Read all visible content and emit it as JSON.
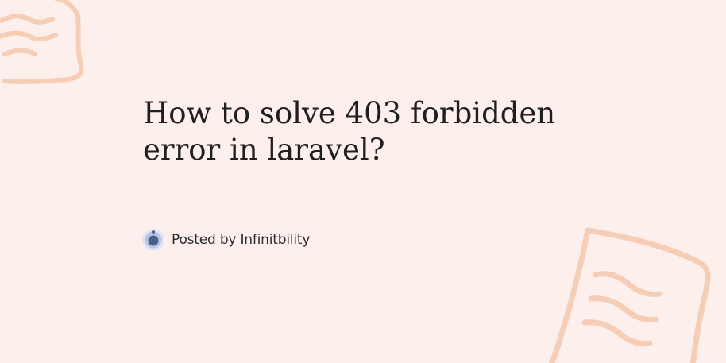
{
  "post": {
    "title": "How to solve 403 forbidden error in laravel?",
    "author_line": "Posted by Infinitbility"
  },
  "icons": {
    "avatar": "infinitbility-logo-icon",
    "decorations": [
      "document-sketch-icon",
      "document-sketch-icon"
    ]
  },
  "colors": {
    "background": "#fdf0ec",
    "title_text": "#1f1f1f",
    "decoration_stroke": "#f6cdb5",
    "avatar_ring": "#c9d3f0",
    "avatar_core": "#4b5f8c"
  }
}
